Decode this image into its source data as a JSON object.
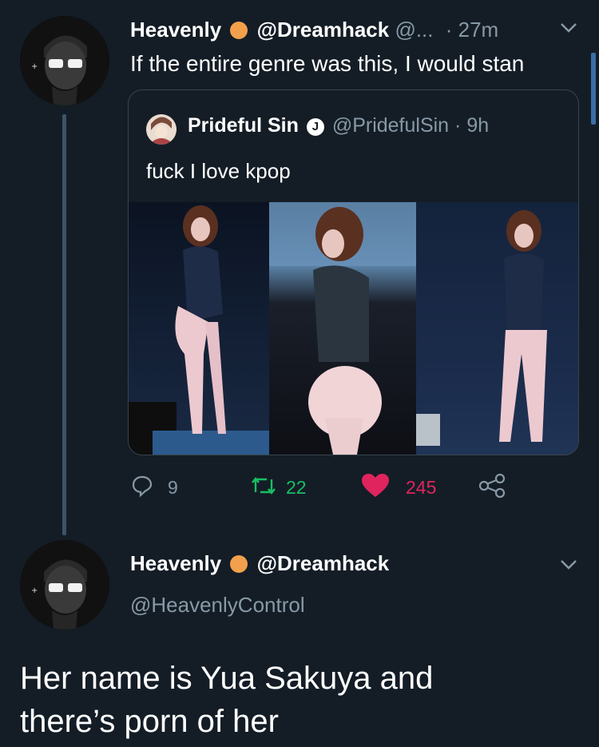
{
  "tweet": {
    "display_name": "Heavenly",
    "handle_name": "@Dreamhack",
    "handle_trunc": "@...",
    "time": "· 27m",
    "text": "If the entire genre was this, I would stan"
  },
  "quote": {
    "display_name": "Prideful Sin",
    "verified_badge": "J",
    "handle": "@PridefulSin",
    "time": "· 9h",
    "text": "fuck I love kpop"
  },
  "actions": {
    "replies": "9",
    "retweets": "22",
    "likes": "245"
  },
  "reply": {
    "display_name": "Heavenly",
    "handle_name": "@Dreamhack",
    "username": "@HeavenlyControl",
    "text_line1": "Her name is Yua Sakuya and",
    "text_line2": "there’s porn of her"
  },
  "colors": {
    "background": "#141d26",
    "like": "#e0245e",
    "retweet": "#17bf63",
    "muted": "#8899a6"
  }
}
